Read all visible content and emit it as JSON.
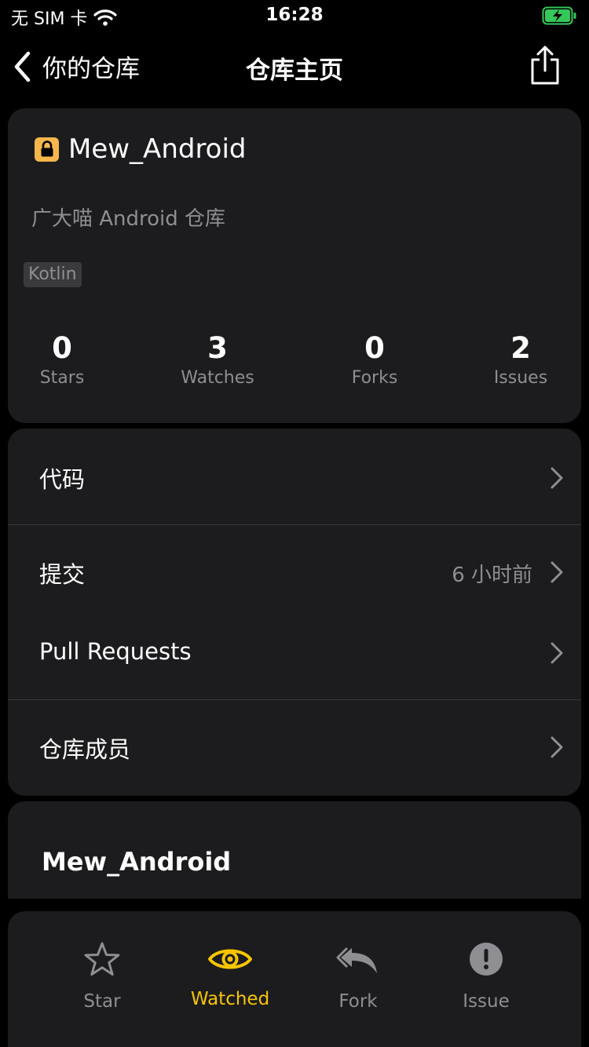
{
  "status_bar": {
    "carrier": "无 SIM 卡",
    "time": "16:28",
    "battery_color": "#35c759"
  },
  "nav": {
    "back_label": "你的仓库",
    "title": "仓库主页"
  },
  "repo": {
    "name": "Mew_Android",
    "private": true,
    "description": "广大喵 Android 仓库",
    "language": "Kotlin",
    "stats": [
      {
        "value": "0",
        "label": "Stars"
      },
      {
        "value": "3",
        "label": "Watches"
      },
      {
        "value": "0",
        "label": "Forks"
      },
      {
        "value": "2",
        "label": "Issues"
      }
    ]
  },
  "menu": [
    {
      "label": "代码",
      "value": ""
    },
    {
      "label": "提交",
      "value": "6 小时前"
    },
    {
      "label": "Pull Requests",
      "value": ""
    },
    {
      "label": "仓库成员",
      "value": ""
    }
  ],
  "readme": {
    "title": "Mew_Android"
  },
  "tabbar": {
    "active_color": "#f7c600",
    "items": [
      {
        "label": "Star",
        "icon": "star-icon"
      },
      {
        "label": "Watched",
        "icon": "eye-icon",
        "active": true
      },
      {
        "label": "Fork",
        "icon": "fork-reply-icon"
      },
      {
        "label": "Issue",
        "icon": "exclamation-icon"
      }
    ]
  }
}
